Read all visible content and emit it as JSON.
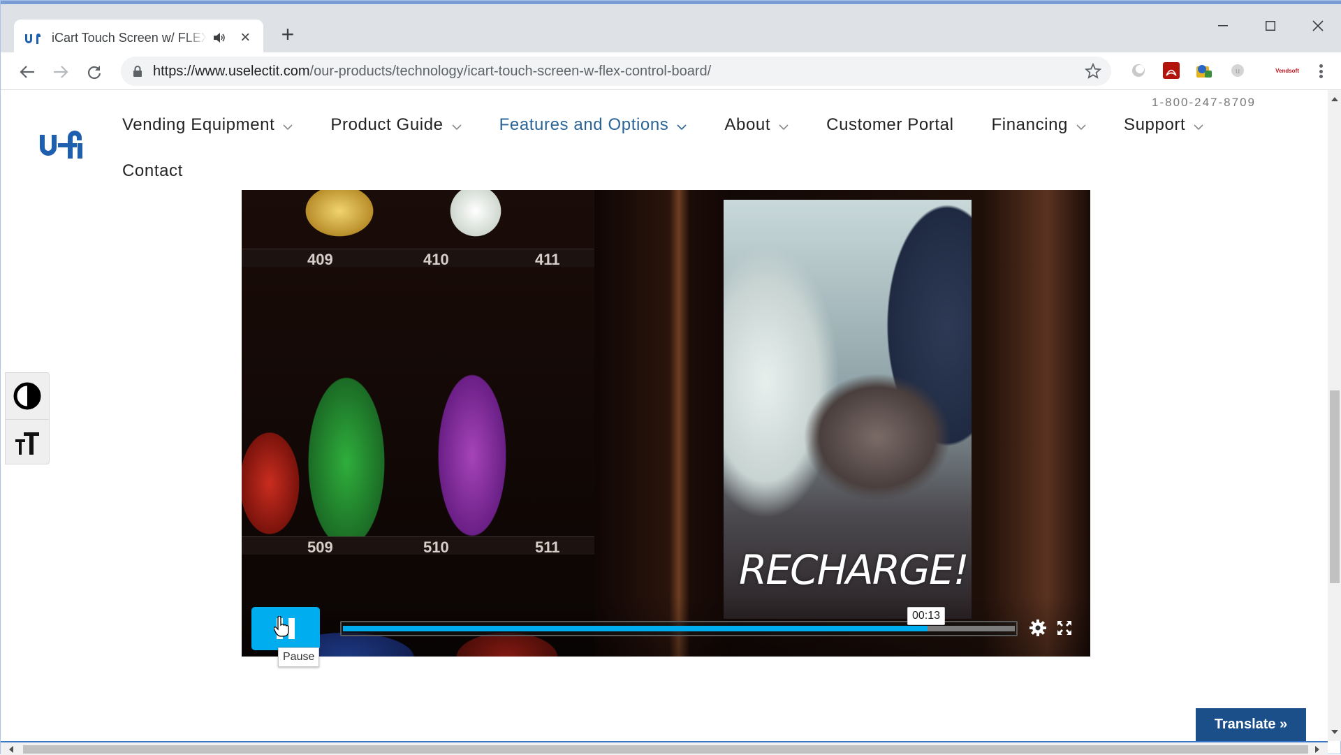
{
  "browser": {
    "tab_title": "iCart Touch Screen w/ FLEX Control Board",
    "url_host": "https://www.uselectit.com",
    "url_path": "/our-products/technology/icart-touch-screen-w-flex-control-board/"
  },
  "site": {
    "phone": "1-800-247-8709",
    "nav_row1": [
      {
        "label": "Vending Equipment",
        "has_dropdown": true,
        "active": false
      },
      {
        "label": "Product Guide",
        "has_dropdown": true,
        "active": false
      },
      {
        "label": "Features and Options",
        "has_dropdown": true,
        "active": true
      },
      {
        "label": "About",
        "has_dropdown": true,
        "active": false
      },
      {
        "label": "Customer Portal",
        "has_dropdown": false,
        "active": false
      },
      {
        "label": "Financing",
        "has_dropdown": true,
        "active": false
      },
      {
        "label": "Support",
        "has_dropdown": true,
        "active": false
      }
    ],
    "nav_row2": [
      {
        "label": "Contact",
        "has_dropdown": false,
        "active": false
      }
    ],
    "accent_color": "#2a6496"
  },
  "video": {
    "shelf_top": [
      "409",
      "410",
      "411"
    ],
    "shelf_bottom": [
      "509",
      "510",
      "511"
    ],
    "overlay_text": "RECHARGE!",
    "current_time": "00:13",
    "progress_fraction": 0.87,
    "pause_tooltip": "Pause",
    "player_color": "#00adef"
  },
  "translate_label": "Translate »"
}
